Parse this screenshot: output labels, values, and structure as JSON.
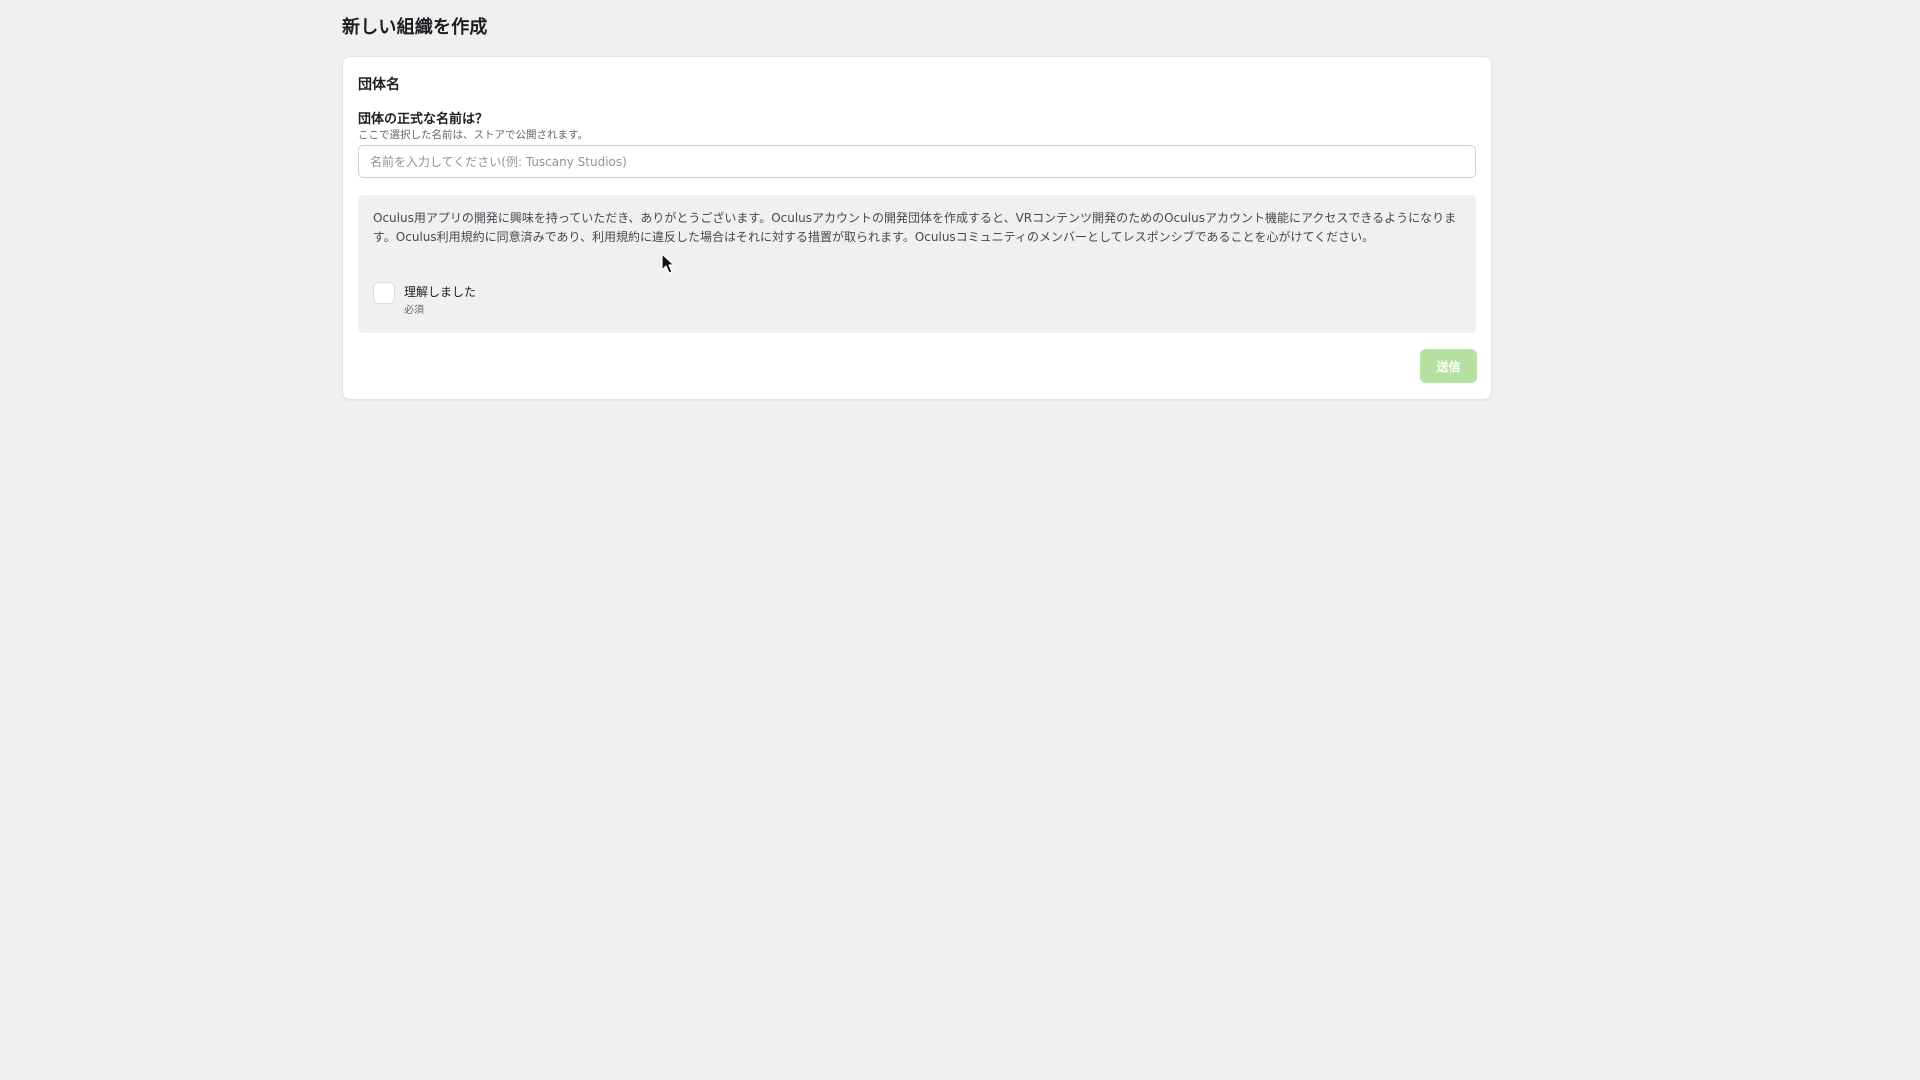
{
  "page": {
    "title": "新しい組織を作成"
  },
  "form": {
    "section_title": "団体名",
    "name_field": {
      "label": "団体の正式な名前は？",
      "help": "ここで選択した名前は、ストアで公開されます。",
      "value": "",
      "placeholder": "名前を入力してください(例: Tuscany Studios)"
    },
    "notice": {
      "text": "Oculus用アプリの開発に興味を持っていただき、ありがとうございます。Oculusアカウントの開発団体を作成すると、VRコンテンツ開発のためのOculusアカウント機能にアクセスできるようになります。Oculus利用規約に同意済みであり、利用規約に違反した場合はそれに対する措置が取られます。Oculusコミュニティのメンバーとしてレスポンシブであることを心がけてください。",
      "checkbox_label": "理解しました",
      "checkbox_required": "必須",
      "checked": false
    },
    "submit_label": "送信",
    "submit_enabled": false
  },
  "colors": {
    "background": "#f0f0f0",
    "card": "#ffffff",
    "submit_disabled": "#b7e1a1"
  },
  "icons": {
    "cursor": "mouse-pointer-icon"
  }
}
